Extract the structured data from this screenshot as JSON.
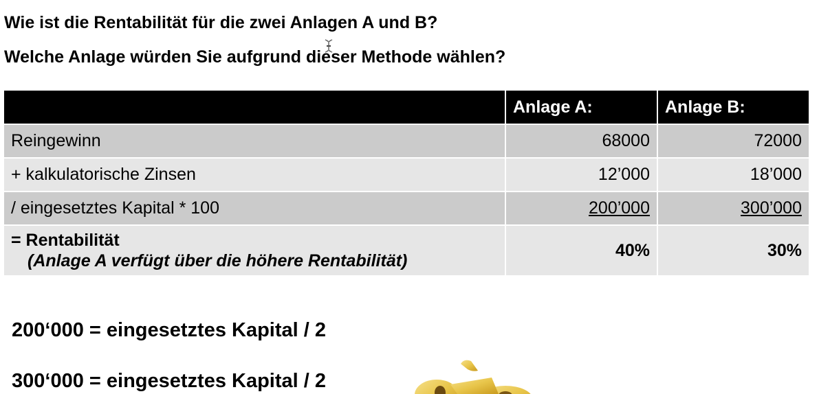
{
  "questions": {
    "line1": "Wie ist die Rentabilität für die zwei Anlagen A und B?",
    "line2": "Welche Anlage würden Sie aufgrund dieser Methode wählen?"
  },
  "table": {
    "headers": [
      "",
      "Anlage A:",
      "Anlage B:"
    ],
    "rows": [
      {
        "label": "Reingewinn",
        "a": "68000",
        "b": "72000"
      },
      {
        "label": "+ kalkulatorische Zinsen",
        "a": "12’000",
        "b": "18’000"
      },
      {
        "label": "/ eingesetztes Kapital * 100",
        "a": "200’000",
        "b": "300’000"
      }
    ],
    "result": {
      "label": "= Rentabilität",
      "note": "(Anlage A verfügt über die höhere Rentabilität)",
      "a": "40%",
      "b": "30%"
    }
  },
  "formulas": {
    "line1": "200‘000 = eingesetztes Kapital / 2",
    "line2": "300‘000 = eingesetztes Kapital / 2"
  },
  "colors": {
    "header_bg": "#000000",
    "row_dark": "#cbcbcb",
    "row_light": "#e6e6e6",
    "gold": "#e8c54a"
  },
  "icons": {
    "cursor": "text-cursor-icon",
    "graphic": "gold-percent-sign-icon"
  }
}
